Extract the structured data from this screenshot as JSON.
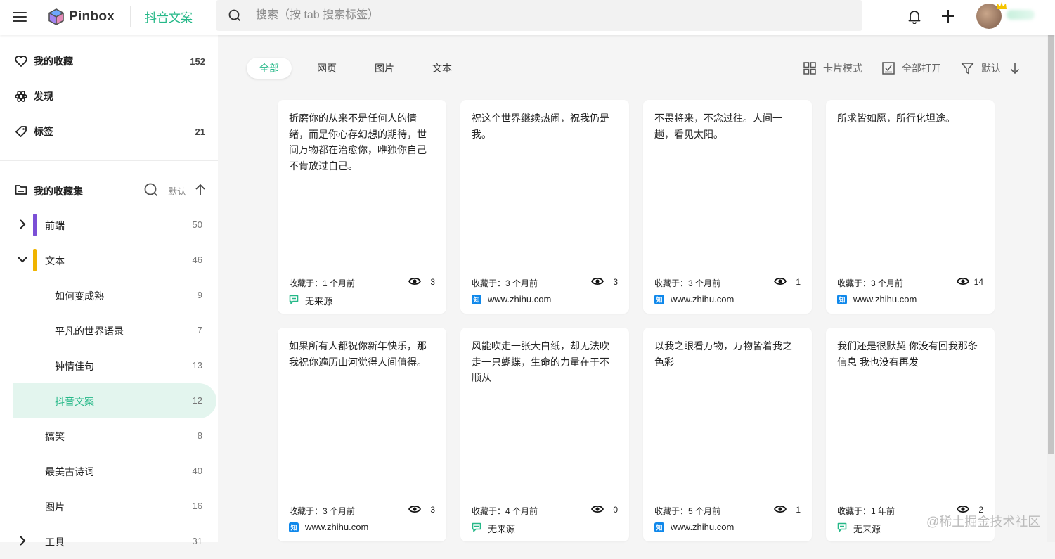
{
  "header": {
    "logo_text": "Pinbox",
    "title": "抖音文案",
    "search_placeholder": "搜索（按 tab 搜索标签）"
  },
  "sidebar": {
    "nav": [
      {
        "label": "我的收藏",
        "count": "152",
        "icon": "heart-icon"
      },
      {
        "label": "发现",
        "count": "",
        "icon": "discover-icon"
      },
      {
        "label": "标签",
        "count": "21",
        "icon": "tag-icon"
      }
    ],
    "collections": {
      "label": "我的收藏集",
      "sort_label": "默认"
    },
    "folders": [
      {
        "label": "前端",
        "count": "50",
        "color": "#7b4fd6",
        "state": "collapsed"
      },
      {
        "label": "文本",
        "count": "46",
        "color": "#f0b400",
        "state": "expanded"
      },
      {
        "label": "如何变成熟",
        "count": "9"
      },
      {
        "label": "平凡的世界语录",
        "count": "7"
      },
      {
        "label": "钟情佳句",
        "count": "13"
      },
      {
        "label": "抖音文案",
        "count": "12",
        "active": true
      },
      {
        "label": "搞笑",
        "count": "8"
      },
      {
        "label": "最美古诗词",
        "count": "40"
      },
      {
        "label": "图片",
        "count": "16"
      },
      {
        "label": "工具",
        "count": "31",
        "state": "collapsed"
      }
    ]
  },
  "filters": [
    "全部",
    "网页",
    "图片",
    "文本"
  ],
  "toolbar": {
    "card_mode": "卡片模式",
    "open_all": "全部打开",
    "sort": "默认"
  },
  "cards": [
    {
      "text": "折磨你的从来不是任何人的情绪，而是你心存幻想的期待，世间万物都在治愈你，唯独你自己不肯放过自己。",
      "saved": "收藏于：1 个月前",
      "views": "3",
      "source": "无来源",
      "source_type": "none"
    },
    {
      "text": "祝这个世界继续热闹，祝我仍是我。",
      "saved": "收藏于：3 个月前",
      "views": "3",
      "source": "www.zhihu.com",
      "source_type": "zhihu"
    },
    {
      "text": "不畏将来，不念过往。人间一趟，看见太阳。",
      "saved": "收藏于：3 个月前",
      "views": "1",
      "source": "www.zhihu.com",
      "source_type": "zhihu"
    },
    {
      "text": "所求皆如愿，所行化坦途。",
      "saved": "收藏于：3 个月前",
      "views": "14",
      "source": "www.zhihu.com",
      "source_type": "zhihu"
    },
    {
      "text": "如果所有人都祝你新年快乐，那我祝你遍历山河觉得人间值得。",
      "saved": "收藏于：3 个月前",
      "views": "3",
      "source": "www.zhihu.com",
      "source_type": "zhihu"
    },
    {
      "text": "风能吹走一张大白纸，却无法吹走一只蝴蝶，生命的力量在于不顺从",
      "saved": "收藏于：4 个月前",
      "views": "0",
      "source": "无来源",
      "source_type": "none"
    },
    {
      "text": "以我之眼看万物，万物皆着我之色彩",
      "saved": "收藏于：5 个月前",
      "views": "1",
      "source": "www.zhihu.com",
      "source_type": "zhihu"
    },
    {
      "text": "我们还是很默契 你没有回我那条信息 我也没有再发",
      "saved": "收藏于：1 年前",
      "views": "2",
      "source": "无来源",
      "source_type": "none"
    }
  ],
  "colors": {
    "accent": "#25b888",
    "zhihu": "#0f88eb"
  },
  "watermark": "@稀土掘金技术社区"
}
